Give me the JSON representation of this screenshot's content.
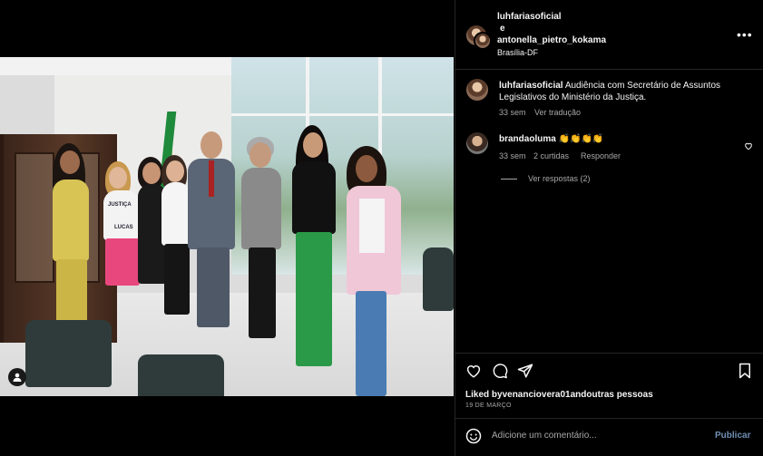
{
  "post": {
    "author": "luhfariasoficial",
    "conjunction": "e",
    "coauthor": "antonella_pietro_kokama",
    "location": "Brasília-DF",
    "more_label": "•••"
  },
  "caption": {
    "user": "luhfariasoficial",
    "text_line1": "Audiência com Secretário de Assuntos",
    "text_line2": "Legislativos do Ministério da Justiça.",
    "time": "33 sem",
    "translate": "Ver tradução"
  },
  "comment": {
    "user": "brandaoluma",
    "text": "👏👏👏👏",
    "time": "33 sem",
    "likes": "2 curtidas",
    "reply": "Responder",
    "view_replies": "Ver respostas (2)"
  },
  "likes": {
    "text": "Liked byvenanciovera01andoutras pessoas",
    "date": "19 DE MARÇO"
  },
  "add_comment": {
    "placeholder": "Adicione um comentário...",
    "publish": "Publicar"
  },
  "photo": {
    "shirt_text_1": "JUSTIÇA",
    "shirt_text_2": "LUCAS"
  },
  "colors": {
    "background": "#000000",
    "text": "#f5f5f5",
    "muted": "#a8a8a8",
    "divider": "#262626"
  },
  "icons": [
    "heart-icon",
    "comment-icon",
    "share-icon",
    "bookmark-icon",
    "emoji-icon",
    "more-icon",
    "user-tag-icon"
  ]
}
